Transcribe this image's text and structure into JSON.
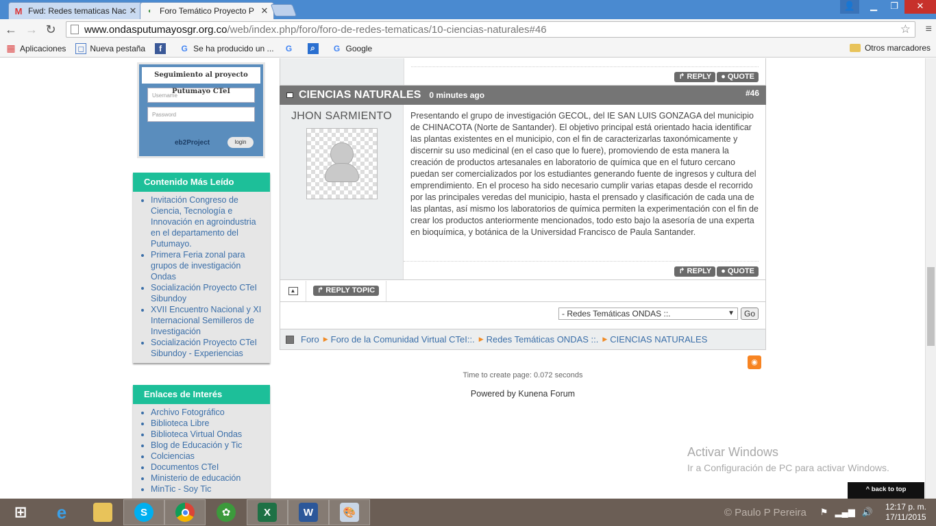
{
  "browser": {
    "tabs": [
      {
        "title": "Fwd: Redes tematicas Nac",
        "icon": "gmail-icon",
        "active": false
      },
      {
        "title": "Foro Temático Proyecto P",
        "icon": "forum-favicon",
        "active": true
      }
    ],
    "url_domain": "www.ondasputumayosgr.org.co",
    "url_path": "/web/index.php/foro/foro-de-redes-tematicas/10-ciencias-naturales#46",
    "bookmarks": [
      {
        "label": "Aplicaciones",
        "icon": "apps-grid-icon"
      },
      {
        "label": "Nueva pestaña",
        "icon": "page-icon"
      },
      {
        "label": "",
        "icon": "facebook-icon"
      },
      {
        "label": "Se ha producido un ...",
        "icon": "google-icon"
      },
      {
        "label": "",
        "icon": "google-icon"
      },
      {
        "label": "",
        "icon": "search-icon"
      },
      {
        "label": "Google",
        "icon": "google-icon"
      }
    ],
    "other_bookmarks": "Otros marcadores"
  },
  "sidebar": {
    "login": {
      "title": "Seguimiento al proyecto Putumayo CTeI",
      "username_placeholder": "Username",
      "password_placeholder": "Password",
      "brand": "eb2Project",
      "login_label": "login"
    },
    "most_read": {
      "title": "Contenido Más Leído",
      "items": [
        "Invitación Congreso de Ciencia, Tecnología e Innovación en agroindustria en el departamento del Putumayo.",
        "Primera Feria zonal para grupos de investigación Ondas",
        "Socialización Proyecto CTeI Sibundoy",
        "XVII Encuentro Nacional y XI Internacional Semilleros de Investigación",
        "Socialización Proyecto CTeI Sibundoy - Experiencias"
      ]
    },
    "links": {
      "title": "Enlaces de Interés",
      "items": [
        "Archivo Fotográfico",
        "Biblioteca Libre",
        "Biblioteca Virtual Ondas",
        "Blog de Educación y Tic",
        "Colciencias",
        "Documentos CTeI",
        "Ministerio de educación",
        "MinTic - Soy Tic"
      ]
    }
  },
  "forum": {
    "reply_label": "REPLY",
    "quote_label": "QUOTE",
    "post": {
      "title": "CIENCIAS NATURALES",
      "time": "0 minutes ago",
      "number": "#46",
      "author": "JHON SARMIENTO",
      "message": "Presentando el grupo de investigación GECOL, del IE SAN LUIS GONZAGA del municipio de CHINACOTA (Norte de Santander). El objetivo principal está orientado hacia identificar las plantas existentes en el municipio, con el fin de caracterizarlas taxonómicamente y discernir su uso medicinal (en el caso que lo fuere), promoviendo de esta manera la creación de productos artesanales en laboratorio de química que en el futuro cercano puedan ser comercializados por los estudiantes generando fuente de ingresos y cultura del emprendimiento. En el proceso ha sido necesario cumplir varias etapas desde el recorrido por las principales veredas del municipio, hasta el prensado y clasificación de cada una de las plantas, así mismo los laboratorios de química permiten la experimentación con el fin de crear los productos anteriormente mencionados, todo esto bajo la asesoría de una experta en bioquímica, y botánica de la Universidad Francisco de Paula Santander."
    },
    "reply_topic_label": "REPLY TOPIC",
    "jump_select": "- Redes Temáticas ONDAS ::.",
    "go_label": "Go",
    "breadcrumb": [
      "Foro",
      "Foro de la Comunidad Virtual CTeI::.",
      "Redes Temáticas ONDAS ::.",
      "CIENCIAS NATURALES"
    ],
    "time_to_create": "Time to create page: 0.072 seconds",
    "powered_by": "Powered by",
    "powered_link": "Kunena Forum"
  },
  "overlay": {
    "activate_title": "Activar Windows",
    "activate_sub": "Ir a Configuración de PC para activar Windows.",
    "back_to_top": "^ back to top"
  },
  "taskbar": {
    "user_watermark": "© Paulo P Pereira",
    "time": "12:17 p. m.",
    "date": "17/11/2015"
  }
}
